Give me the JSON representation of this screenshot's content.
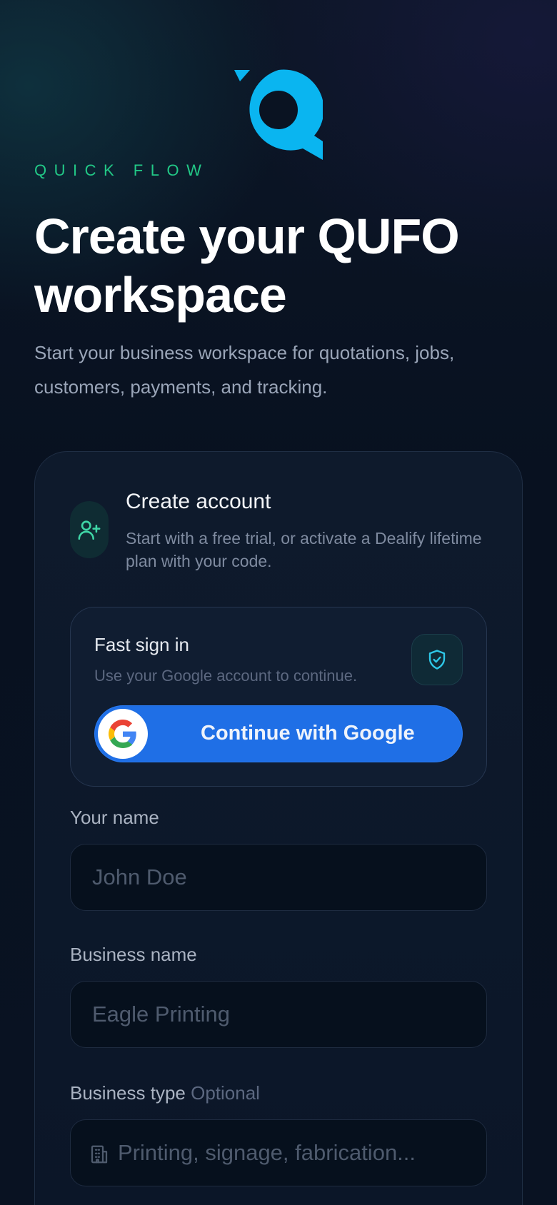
{
  "brand": {
    "eyebrow": "QUICK FLOW",
    "accent": "#0ab5f0",
    "eyebrow_color": "#22c987"
  },
  "header": {
    "title": "Create your QUFO workspace",
    "subtitle": "Start your business workspace for quotations, jobs, customers, payments, and tracking."
  },
  "account": {
    "icon": "user-plus-icon",
    "title": "Create account",
    "subtitle": "Start with a free trial, or activate a Dealify lifetime plan with your code."
  },
  "fast_sign_in": {
    "title": "Fast sign in",
    "subtitle": "Use your Google account to continue.",
    "badge_icon": "shield-check-icon",
    "google_button_label": "Continue with Google",
    "google_button_color": "#1f6fe6"
  },
  "form": {
    "name": {
      "label": "Your name",
      "placeholder": "John Doe",
      "value": ""
    },
    "business": {
      "label": "Business name",
      "placeholder": "Eagle Printing",
      "value": ""
    },
    "business_type": {
      "label": "Business type",
      "optional_tag": "Optional",
      "placeholder": "Printing, signage, fabrication...",
      "icon": "building-icon",
      "value": ""
    }
  }
}
